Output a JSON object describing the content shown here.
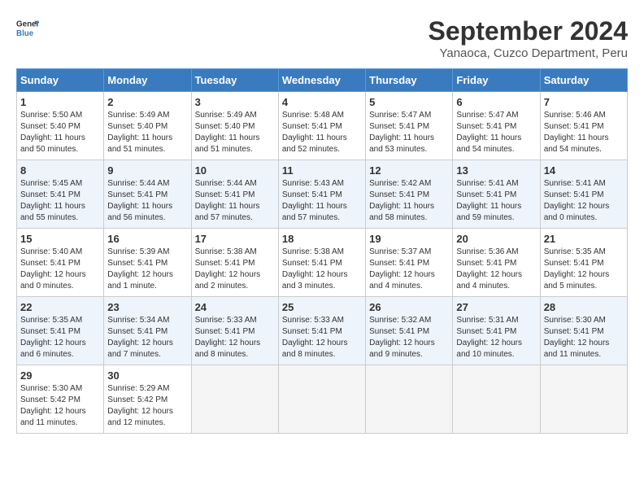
{
  "logo": {
    "line1": "General",
    "line2": "Blue"
  },
  "title": "September 2024",
  "subtitle": "Yanaoca, Cuzco Department, Peru",
  "weekdays": [
    "Sunday",
    "Monday",
    "Tuesday",
    "Wednesday",
    "Thursday",
    "Friday",
    "Saturday"
  ],
  "weeks": [
    [
      {
        "day": "1",
        "sunrise": "5:50 AM",
        "sunset": "5:40 PM",
        "daylight": "11 hours and 50 minutes."
      },
      {
        "day": "2",
        "sunrise": "5:49 AM",
        "sunset": "5:40 PM",
        "daylight": "11 hours and 51 minutes."
      },
      {
        "day": "3",
        "sunrise": "5:49 AM",
        "sunset": "5:40 PM",
        "daylight": "11 hours and 51 minutes."
      },
      {
        "day": "4",
        "sunrise": "5:48 AM",
        "sunset": "5:41 PM",
        "daylight": "11 hours and 52 minutes."
      },
      {
        "day": "5",
        "sunrise": "5:47 AM",
        "sunset": "5:41 PM",
        "daylight": "11 hours and 53 minutes."
      },
      {
        "day": "6",
        "sunrise": "5:47 AM",
        "sunset": "5:41 PM",
        "daylight": "11 hours and 54 minutes."
      },
      {
        "day": "7",
        "sunrise": "5:46 AM",
        "sunset": "5:41 PM",
        "daylight": "11 hours and 54 minutes."
      }
    ],
    [
      {
        "day": "8",
        "sunrise": "5:45 AM",
        "sunset": "5:41 PM",
        "daylight": "11 hours and 55 minutes."
      },
      {
        "day": "9",
        "sunrise": "5:44 AM",
        "sunset": "5:41 PM",
        "daylight": "11 hours and 56 minutes."
      },
      {
        "day": "10",
        "sunrise": "5:44 AM",
        "sunset": "5:41 PM",
        "daylight": "11 hours and 57 minutes."
      },
      {
        "day": "11",
        "sunrise": "5:43 AM",
        "sunset": "5:41 PM",
        "daylight": "11 hours and 57 minutes."
      },
      {
        "day": "12",
        "sunrise": "5:42 AM",
        "sunset": "5:41 PM",
        "daylight": "11 hours and 58 minutes."
      },
      {
        "day": "13",
        "sunrise": "5:41 AM",
        "sunset": "5:41 PM",
        "daylight": "11 hours and 59 minutes."
      },
      {
        "day": "14",
        "sunrise": "5:41 AM",
        "sunset": "5:41 PM",
        "daylight": "12 hours and 0 minutes."
      }
    ],
    [
      {
        "day": "15",
        "sunrise": "5:40 AM",
        "sunset": "5:41 PM",
        "daylight": "12 hours and 0 minutes."
      },
      {
        "day": "16",
        "sunrise": "5:39 AM",
        "sunset": "5:41 PM",
        "daylight": "12 hours and 1 minute."
      },
      {
        "day": "17",
        "sunrise": "5:38 AM",
        "sunset": "5:41 PM",
        "daylight": "12 hours and 2 minutes."
      },
      {
        "day": "18",
        "sunrise": "5:38 AM",
        "sunset": "5:41 PM",
        "daylight": "12 hours and 3 minutes."
      },
      {
        "day": "19",
        "sunrise": "5:37 AM",
        "sunset": "5:41 PM",
        "daylight": "12 hours and 4 minutes."
      },
      {
        "day": "20",
        "sunrise": "5:36 AM",
        "sunset": "5:41 PM",
        "daylight": "12 hours and 4 minutes."
      },
      {
        "day": "21",
        "sunrise": "5:35 AM",
        "sunset": "5:41 PM",
        "daylight": "12 hours and 5 minutes."
      }
    ],
    [
      {
        "day": "22",
        "sunrise": "5:35 AM",
        "sunset": "5:41 PM",
        "daylight": "12 hours and 6 minutes."
      },
      {
        "day": "23",
        "sunrise": "5:34 AM",
        "sunset": "5:41 PM",
        "daylight": "12 hours and 7 minutes."
      },
      {
        "day": "24",
        "sunrise": "5:33 AM",
        "sunset": "5:41 PM",
        "daylight": "12 hours and 8 minutes."
      },
      {
        "day": "25",
        "sunrise": "5:33 AM",
        "sunset": "5:41 PM",
        "daylight": "12 hours and 8 minutes."
      },
      {
        "day": "26",
        "sunrise": "5:32 AM",
        "sunset": "5:41 PM",
        "daylight": "12 hours and 9 minutes."
      },
      {
        "day": "27",
        "sunrise": "5:31 AM",
        "sunset": "5:41 PM",
        "daylight": "12 hours and 10 minutes."
      },
      {
        "day": "28",
        "sunrise": "5:30 AM",
        "sunset": "5:41 PM",
        "daylight": "12 hours and 11 minutes."
      }
    ],
    [
      {
        "day": "29",
        "sunrise": "5:30 AM",
        "sunset": "5:42 PM",
        "daylight": "12 hours and 11 minutes."
      },
      {
        "day": "30",
        "sunrise": "5:29 AM",
        "sunset": "5:42 PM",
        "daylight": "12 hours and 12 minutes."
      },
      null,
      null,
      null,
      null,
      null
    ]
  ]
}
